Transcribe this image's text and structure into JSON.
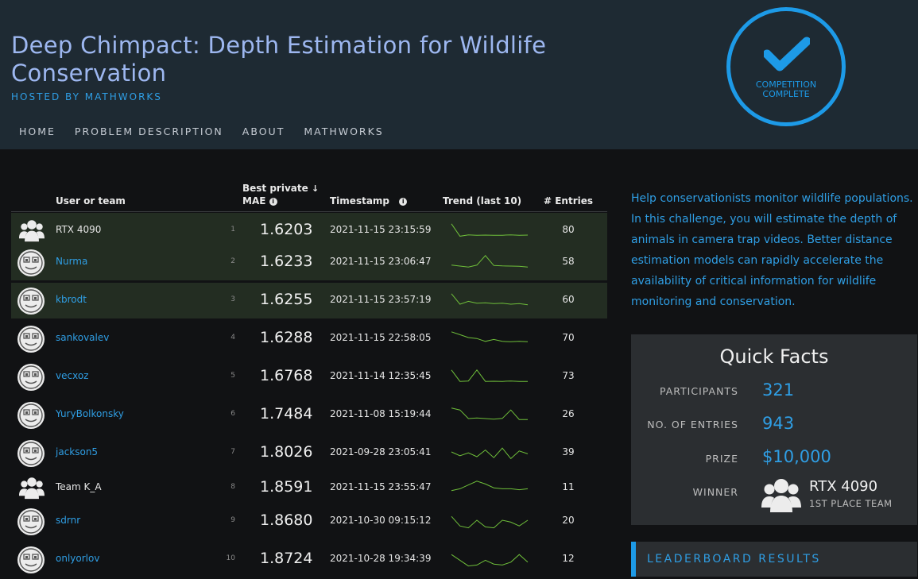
{
  "header": {
    "title": "Deep Chimpact: Depth Estimation for Wildlife Conservation",
    "hosted_by": "HOSTED BY MATHWORKS",
    "badge_line1": "COMPETITION",
    "badge_line2": "COMPLETE",
    "nav": [
      "HOME",
      "PROBLEM DESCRIPTION",
      "ABOUT",
      "MATHWORKS"
    ]
  },
  "leaderboard": {
    "columns": {
      "user": "User or team",
      "best_private": "Best private",
      "sort_icon": "↓",
      "mae": "MAE",
      "timestamp": "Timestamp",
      "trend": "Trend (last 10)",
      "entries": "# Entries"
    },
    "rows": [
      {
        "rank": "1",
        "name": "RTX 4090",
        "type": "team",
        "score": "1.6203",
        "timestamp": "2021-11-15 23:15:59",
        "entries": "80",
        "highlight": true,
        "trend": [
          0.2,
          0.85,
          0.78,
          0.8,
          0.79,
          0.8,
          0.8,
          0.78,
          0.8,
          0.79
        ]
      },
      {
        "rank": "2",
        "name": "Nurma",
        "type": "user",
        "score": "1.6233",
        "timestamp": "2021-11-15 23:06:47",
        "entries": "58",
        "highlight": true,
        "trend": [
          0.7,
          0.75,
          0.8,
          0.7,
          0.2,
          0.72,
          0.74,
          0.75,
          0.76,
          0.8
        ]
      },
      {
        "rank": "3",
        "name": "kbrodt",
        "type": "user",
        "score": "1.6255",
        "timestamp": "2021-11-15 23:57:19",
        "entries": "60",
        "highlight": true,
        "trend": [
          0.2,
          0.75,
          0.6,
          0.7,
          0.68,
          0.72,
          0.7,
          0.75,
          0.72,
          0.78
        ]
      },
      {
        "rank": "4",
        "name": "sankovalev",
        "type": "user",
        "score": "1.6288",
        "timestamp": "2021-11-15 22:58:05",
        "entries": "70",
        "highlight": false,
        "trend": [
          0.2,
          0.35,
          0.5,
          0.55,
          0.7,
          0.6,
          0.7,
          0.72,
          0.7,
          0.72
        ]
      },
      {
        "rank": "5",
        "name": "vecxoz",
        "type": "user",
        "score": "1.6768",
        "timestamp": "2021-11-14 12:35:45",
        "entries": "73",
        "highlight": false,
        "trend": [
          0.2,
          0.8,
          0.78,
          0.2,
          0.8,
          0.79,
          0.8,
          0.78,
          0.8,
          0.8
        ]
      },
      {
        "rank": "6",
        "name": "YuryBolkonsky",
        "type": "user",
        "score": "1.7484",
        "timestamp": "2021-11-08 15:19:44",
        "entries": "26",
        "highlight": false,
        "trend": [
          0.2,
          0.3,
          0.75,
          0.72,
          0.75,
          0.78,
          0.74,
          0.3,
          0.8,
          0.8
        ]
      },
      {
        "rank": "7",
        "name": "jackson5",
        "type": "user",
        "score": "1.8026",
        "timestamp": "2021-09-28 23:05:41",
        "entries": "39",
        "highlight": false,
        "trend": [
          0.5,
          0.7,
          0.55,
          0.75,
          0.4,
          0.8,
          0.3,
          0.85,
          0.45,
          0.6
        ]
      },
      {
        "rank": "8",
        "name": "Team K_A",
        "type": "team",
        "score": "1.8591",
        "timestamp": "2021-11-15 23:55:47",
        "entries": "11",
        "highlight": false,
        "trend": [
          0.7,
          0.6,
          0.4,
          0.2,
          0.35,
          0.55,
          0.6,
          0.6,
          0.65,
          0.6
        ]
      },
      {
        "rank": "9",
        "name": "sdrnr",
        "type": "user",
        "score": "1.8680",
        "timestamp": "2021-10-30 09:15:12",
        "entries": "20",
        "highlight": false,
        "trend": [
          0.3,
          0.8,
          0.9,
          0.5,
          0.85,
          0.9,
          0.5,
          0.6,
          0.8,
          0.5
        ]
      },
      {
        "rank": "10",
        "name": "onlyorlov",
        "type": "user",
        "score": "1.8724",
        "timestamp": "2021-10-28 19:34:39",
        "entries": "12",
        "highlight": false,
        "trend": [
          0.3,
          0.6,
          0.9,
          0.85,
          0.6,
          0.8,
          0.85,
          0.7,
          0.3,
          0.7
        ]
      }
    ]
  },
  "sidebar": {
    "description": "Help conservationists monitor wildlife populations. In this challenge, you will estimate the depth of animals in camera trap videos. Better distance estimation models can rapidly accelerate the availability of critical information for wildlife monitoring and conservation.",
    "quick_facts": {
      "title": "Quick Facts",
      "participants_label": "PARTICIPANTS",
      "participants": "321",
      "entries_label": "NO. OF ENTRIES",
      "entries": "943",
      "prize_label": "PRIZE",
      "prize": "$10,000",
      "winner_label": "WINNER",
      "winner_name": "RTX 4090",
      "winner_sub": "1ST PLACE TEAM"
    },
    "leaderboard_results": "LEADERBOARD RESULTS"
  },
  "colors": {
    "accent": "#1d9ae7",
    "link": "#2f9ee4",
    "trend_line": "#6fbf3a",
    "header_bg": "#1e2a33"
  }
}
